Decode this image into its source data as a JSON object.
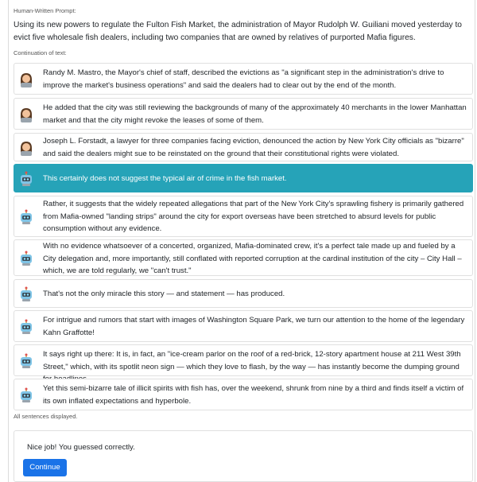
{
  "header": {
    "prompt_label": "Human-Written Prompt:"
  },
  "prompt": {
    "text": "Using its new powers to regulate the Fulton Fish Market, the administration of Mayor Rudolph W. Guiliani moved yesterday to evict five wholesale fish dealers, including two companies that are owned by relatives of purported Mafia figures."
  },
  "continuation": {
    "label": "Continuation of text:",
    "sentences": [
      {
        "author": "human",
        "avatar_icon": "woman-technologist-icon",
        "text": "Randy M. Mastro, the Mayor's chief of staff, described the evictions as \"a significant step in the administration's drive to improve the market's business operations\" and said the dealers had to clear out by the end of the month."
      },
      {
        "author": "human",
        "avatar_icon": "woman-technologist-icon",
        "text": "He added that the city was still reviewing the backgrounds of many of the approximately 40 merchants in the lower Manhattan market and that the city might revoke the leases of some of them."
      },
      {
        "author": "human",
        "avatar_icon": "woman-technologist-icon",
        "text": "Joseph L. Forstadt, a lawyer for three companies facing eviction, denounced the action by New York City officials as \"bizarre\" and said the dealers might sue to be reinstated on the ground that their constitutional rights were violated."
      },
      {
        "author": "machine",
        "avatar_icon": "robot-icon",
        "highlighted": true,
        "text": "This certainly does not suggest the typical air of crime in the fish market."
      },
      {
        "author": "machine",
        "avatar_icon": "robot-icon",
        "text": "Rather, it suggests that the widely repeated allegations that part of the New York City's sprawling fishery is primarily gathered from Mafia-owned \"landing strips\" around the city for export overseas have been stretched to absurd levels for public consumption without any evidence."
      },
      {
        "author": "machine",
        "avatar_icon": "robot-icon",
        "text": "With no evidence whatsoever of a concerted, organized, Mafia-dominated crew, it's a perfect tale made up and fueled by a City delegation and, more importantly, still conflated with reported corruption at the cardinal institution of the city – City Hall – which, we are told regularly, we \"can't trust.\""
      },
      {
        "author": "machine",
        "avatar_icon": "robot-icon",
        "text": "That's not the only miracle this story — and statement — has produced."
      },
      {
        "author": "machine",
        "avatar_icon": "robot-icon",
        "text": "For intrigue and rumors that start with images of Washington Square Park, we turn our attention to the home of the legendary Kahn Graffotte!"
      },
      {
        "author": "machine",
        "avatar_icon": "robot-icon",
        "text": "It says right up there: It is, in fact, an \"ice-cream parlor on the roof of a red-brick, 12-story apartment house at 211 West 39th Street,\" which, with its spotlit neon sign — which they love to flash, by the way — has instantly become the dumping ground for headlines."
      },
      {
        "author": "machine",
        "avatar_icon": "robot-icon",
        "text": "Yet this semi-bizarre tale of illicit spirits with fish has, over the weekend, shrunk from nine by a third and finds itself a victim of its own inflated expectations and hyperbole."
      }
    ],
    "footer": "All sentences displayed."
  },
  "result": {
    "message": "Nice job! You guessed correctly.",
    "button_label": "Continue",
    "button_color": "#1a73e8",
    "highlight_color": "#26a3b8"
  }
}
